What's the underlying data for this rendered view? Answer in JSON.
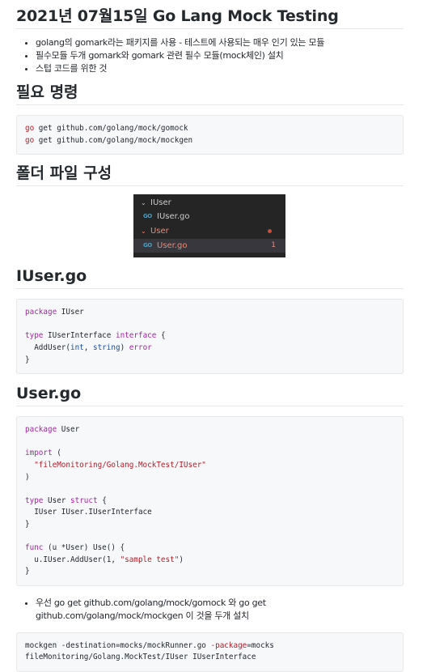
{
  "title": "2021년 07월15일 Go Lang Mock Testing",
  "intro_bullets": [
    "golang의 gomark라는 패키지를 사용 - 테스트에 사용되는 매우 인기 있는 모듈",
    "필수모듈 두개 gomark와 gomark 관련 필수 모듈(mock체인) 설치",
    "스텁 코드를 위한 것"
  ],
  "section_commands": {
    "heading": "필요 명령",
    "lines": [
      {
        "kw": "go",
        "rest": " get github.com/golang/mock/gomock"
      },
      {
        "kw": "go",
        "rest": " get github.com/golang/mock/mockgen"
      }
    ]
  },
  "section_folder": {
    "heading": "폴더 파일 구성",
    "explorer": {
      "items": [
        {
          "label": "IUser",
          "kind": "folder"
        },
        {
          "label": "IUser.go",
          "kind": "file",
          "icon": "go-file-icon"
        },
        {
          "label": "User",
          "kind": "folder"
        },
        {
          "label": "User.go",
          "kind": "file",
          "icon": "go-file-icon",
          "badge": "1"
        }
      ],
      "colors": {
        "bg": "#252526",
        "error": "#f48771",
        "selected": "#37373d"
      }
    }
  },
  "section_iuser": {
    "heading": "IUser.go",
    "code": {
      "kw_package": "package",
      "pkg": "IUser",
      "kw_type": "type",
      "name": "IUserInterface",
      "kw_interface": "interface",
      "brace_open": "{",
      "method": "AddUser(",
      "p1": "int",
      "sep": ", ",
      "p2": "string",
      "ret": ") ",
      "ret_type": "error",
      "brace_close": "}"
    }
  },
  "section_user": {
    "heading": "User.go",
    "code": {
      "kw_package": "package",
      "pkg": "User",
      "kw_import": "import",
      "paren_open": "(",
      "import_path": "\"fileMonitoring/Golang.MockTest/IUser\"",
      "paren_close": ")",
      "kw_type": "type",
      "struct_name": "User",
      "kw_struct": "struct",
      "brace_open": "{",
      "field": "IUser IUser.IUserInterface",
      "brace_close": "}",
      "kw_func": "func",
      "func_sig": "(u *User) Use() {",
      "call_prefix": "u.IUser.AddUser(1, ",
      "call_arg": "\"sample test\"",
      "call_suffix": ")",
      "func_close": "}"
    }
  },
  "outro_bullet": "우선 go get github.com/golang/mock/gomock 와 go get github.com/golang/mock/mockgen 이 것을 두개 설치",
  "mockgen": {
    "line1_a": "mockgen -destination=mocks/mockRunner.go ",
    "line1_flag": "-package",
    "line1_b": "=mocks",
    "line2": "fileMonitoring/Golang.MockTest/IUser IUserInterface"
  }
}
